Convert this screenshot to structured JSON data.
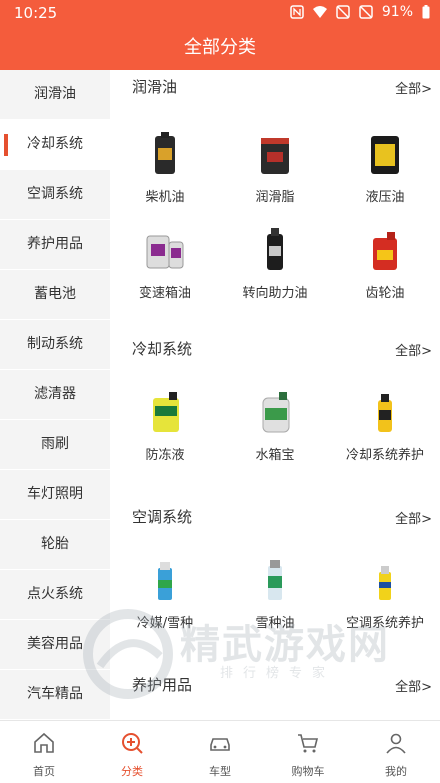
{
  "status": {
    "time": "10:25",
    "battery": "91%"
  },
  "header": {
    "title": "全部分类"
  },
  "sidebar": {
    "items": [
      {
        "label": "润滑油"
      },
      {
        "label": "冷却系统"
      },
      {
        "label": "空调系统"
      },
      {
        "label": "养护用品"
      },
      {
        "label": "蓄电池"
      },
      {
        "label": "制动系统"
      },
      {
        "label": "滤清器"
      },
      {
        "label": "雨刷"
      },
      {
        "label": "车灯照明"
      },
      {
        "label": "轮胎"
      },
      {
        "label": "点火系统"
      },
      {
        "label": "美容用品"
      },
      {
        "label": "汽车精品"
      }
    ]
  },
  "sections": [
    {
      "title": "润滑油",
      "all": "全部>",
      "items": [
        {
          "label": "柴机油",
          "icon": "diesel-oil-bottle"
        },
        {
          "label": "润滑脂",
          "icon": "grease-tub"
        },
        {
          "label": "液压油",
          "icon": "hydraulic-oil-drum"
        },
        {
          "label": "变速箱油",
          "icon": "transmission-oil-bottles"
        },
        {
          "label": "转向助力油",
          "icon": "power-steering-bottle"
        },
        {
          "label": "齿轮油",
          "icon": "gear-oil-jug"
        }
      ]
    },
    {
      "title": "冷却系统",
      "all": "全部>",
      "items": [
        {
          "label": "防冻液",
          "icon": "antifreeze-jug"
        },
        {
          "label": "水箱宝",
          "icon": "radiator-additive-bottle"
        },
        {
          "label": "冷却系统养护",
          "icon": "coolant-care-bottle"
        }
      ]
    },
    {
      "title": "空调系统",
      "all": "全部>",
      "items": [
        {
          "label": "冷媒/雪种",
          "icon": "refrigerant-can"
        },
        {
          "label": "雪种油",
          "icon": "refrigerant-oil-can"
        },
        {
          "label": "空调系统养护",
          "icon": "ac-care-can"
        }
      ]
    },
    {
      "title": "养护用品",
      "all": "全部>",
      "items": []
    }
  ],
  "tabs": [
    {
      "label": "首页",
      "icon": "home-icon"
    },
    {
      "label": "分类",
      "icon": "category-search-icon"
    },
    {
      "label": "车型",
      "icon": "car-icon"
    },
    {
      "label": "购物车",
      "icon": "cart-icon"
    },
    {
      "label": "我的",
      "icon": "user-icon"
    }
  ],
  "watermark": {
    "title": "精武游戏网",
    "subtitle": "排行榜专家"
  },
  "colors": {
    "accent": "#F45C3C",
    "active": "#E5502F"
  }
}
